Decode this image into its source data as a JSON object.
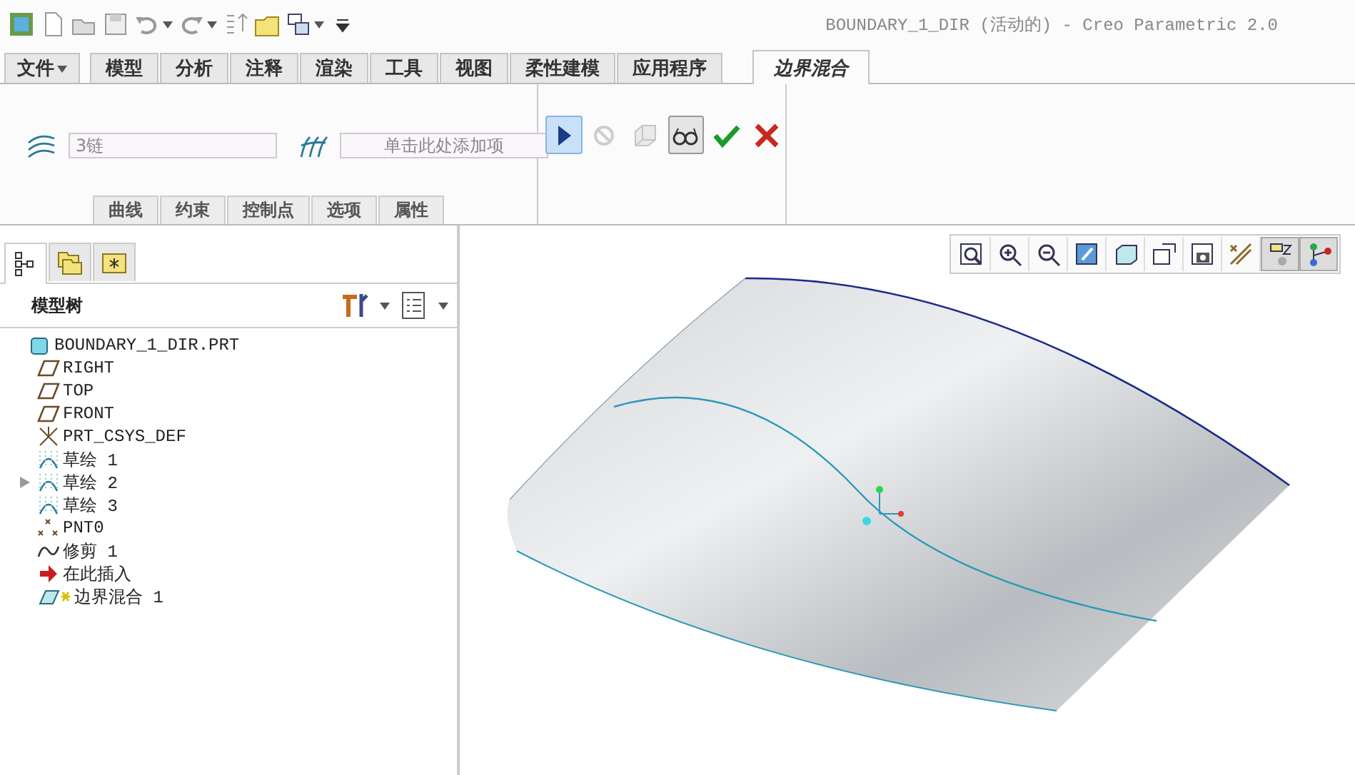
{
  "window": {
    "title": "BOUNDARY_1_DIR (活动的) - Creo Parametric 2.0"
  },
  "quick_access": [
    {
      "kind": "app"
    },
    {
      "kind": "new"
    },
    {
      "kind": "open"
    },
    {
      "kind": "save"
    },
    {
      "kind": "undo",
      "dropdown": true
    },
    {
      "kind": "redo",
      "dropdown": true
    },
    {
      "kind": "regenerate"
    },
    {
      "kind": "folder"
    },
    {
      "kind": "windows",
      "dropdown": true
    },
    {
      "kind": "customize"
    }
  ],
  "ribbon_tabs": [
    {
      "label": "文件",
      "menu": true,
      "selected": false
    },
    {
      "label": "模型",
      "menu": false,
      "selected": false
    },
    {
      "label": "分析",
      "menu": false,
      "selected": false
    },
    {
      "label": "注释",
      "menu": false,
      "selected": false
    },
    {
      "label": "渲染",
      "menu": false,
      "selected": false
    },
    {
      "label": "工具",
      "menu": false,
      "selected": false
    },
    {
      "label": "视图",
      "menu": false,
      "selected": false
    },
    {
      "label": "柔性建模",
      "menu": false,
      "selected": false
    },
    {
      "label": "应用程序",
      "menu": false,
      "selected": false
    },
    {
      "label": "边界混合",
      "menu": false,
      "selected": true
    }
  ],
  "dashboard": {
    "collectors": [
      {
        "kind": "first",
        "value": "3链"
      },
      {
        "kind": "second",
        "placeholder": "单击此处添加项"
      }
    ],
    "controls": [
      {
        "kind": "play",
        "selected": true,
        "disabled": false
      },
      {
        "kind": "pause",
        "selected": false,
        "disabled": true
      },
      {
        "kind": "preview",
        "selected": false,
        "disabled": true
      },
      {
        "kind": "glasses",
        "selected": true,
        "disabled": false
      },
      {
        "kind": "ok",
        "selected": false,
        "disabled": false
      },
      {
        "kind": "cancel",
        "selected": false,
        "disabled": false
      }
    ],
    "panel_tabs": [
      "曲线",
      "约束",
      "控制点",
      "选项",
      "属性"
    ]
  },
  "navigator": {
    "tabs": [
      {
        "kind": "tree",
        "selected": true
      },
      {
        "kind": "folders",
        "selected": false
      },
      {
        "kind": "favorites",
        "selected": false
      }
    ],
    "title": "模型树",
    "tree": [
      {
        "label": "BOUNDARY_1_DIR.PRT",
        "kind": "part",
        "expandable": false,
        "children": [
          {
            "label": "RIGHT",
            "kind": "plane",
            "expandable": false
          },
          {
            "label": "TOP",
            "kind": "plane",
            "expandable": false
          },
          {
            "label": "FRONT",
            "kind": "plane",
            "expandable": false
          },
          {
            "label": "PRT_CSYS_DEF",
            "kind": "csys",
            "expandable": false
          },
          {
            "label": "草绘 1",
            "kind": "sketch",
            "expandable": false
          },
          {
            "label": "草绘 2",
            "kind": "sketch",
            "expandable": true
          },
          {
            "label": "草绘 3",
            "kind": "sketch",
            "expandable": false
          },
          {
            "label": "PNT0",
            "kind": "point",
            "expandable": false
          },
          {
            "label": "修剪 1",
            "kind": "curve",
            "expandable": false
          },
          {
            "label": "在此插入",
            "kind": "insert",
            "expandable": false
          },
          {
            "label": "边界混合 1",
            "kind": "boundary",
            "expandable": false
          }
        ]
      }
    ]
  },
  "view_toolbar": [
    {
      "kind": "refit",
      "pressed": false
    },
    {
      "kind": "zoom-in",
      "pressed": false
    },
    {
      "kind": "zoom-out",
      "pressed": false
    },
    {
      "kind": "repaint",
      "pressed": false
    },
    {
      "kind": "display-style",
      "pressed": false
    },
    {
      "kind": "saved-views",
      "pressed": false
    },
    {
      "kind": "view-manager",
      "pressed": false
    },
    {
      "kind": "datum-display",
      "pressed": false
    },
    {
      "kind": "annotation-display",
      "pressed": true
    },
    {
      "kind": "spin-center",
      "pressed": true
    }
  ]
}
